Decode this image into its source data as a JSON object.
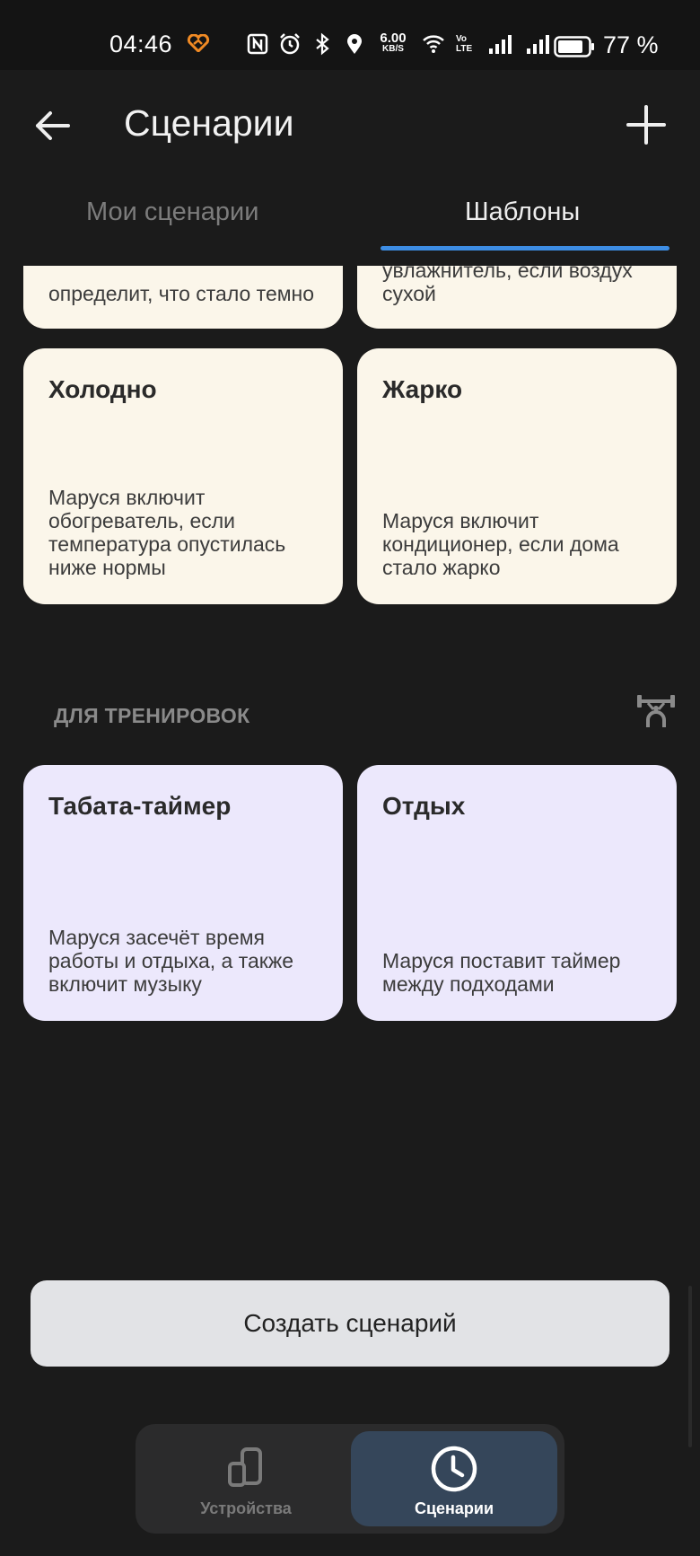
{
  "status_bar": {
    "time": "04:46",
    "speed_value": "6.00",
    "speed_unit": "KB/S",
    "volte": "Vo LTE",
    "battery_percent": "77 %"
  },
  "header": {
    "title": "Сценарии"
  },
  "tabs": [
    {
      "label": "Мои сценарии",
      "active": false
    },
    {
      "label": "Шаблоны",
      "active": true
    }
  ],
  "cards_top_partial": [
    {
      "desc": "определит, что стало темно"
    },
    {
      "desc": "увлажнитель, если воздух сухой"
    }
  ],
  "cards_climate": [
    {
      "title": "Холодно",
      "desc": "Маруся включит обогреватель, если температура опустилась ниже нормы"
    },
    {
      "title": "Жарко",
      "desc": "Маруся включит кондиционер, если дома стало жарко"
    }
  ],
  "section_training": {
    "label": "ДЛЯ ТРЕНИРОВОК",
    "icon": "barbell-icon"
  },
  "cards_training": [
    {
      "title": "Табата-таймер",
      "desc": "Маруся засечёт время работы и отдыха, а также включит музыку"
    },
    {
      "title": "Отдых",
      "desc": "Маруся поставит таймер между подходами"
    }
  ],
  "create_button": {
    "label": "Создать сценарий"
  },
  "bottom_nav": [
    {
      "label": "Устройства",
      "icon": "devices-icon",
      "active": false
    },
    {
      "label": "Сценарии",
      "icon": "clock-icon",
      "active": true
    }
  ],
  "colors": {
    "background": "#1b1b1b",
    "accent_underline": "#3d8de4",
    "card_warm": "#fbf6ea",
    "card_violet": "#ece8fc",
    "nav_active": "#35465a",
    "heart_orange": "#f08a24"
  }
}
